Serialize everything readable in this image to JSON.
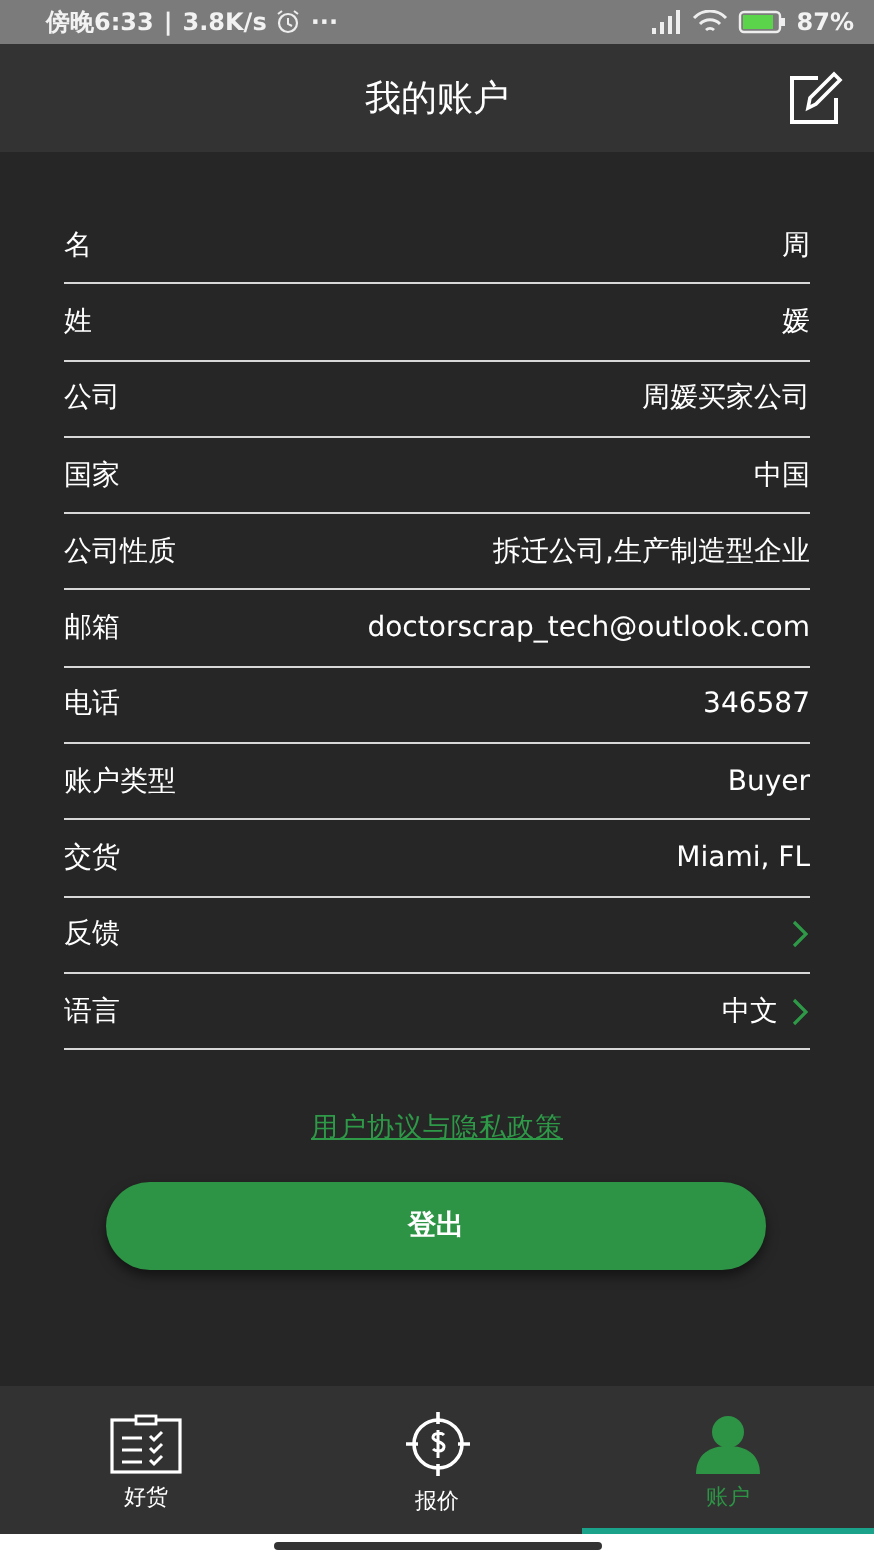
{
  "status_bar": {
    "time": "傍晚6:33",
    "separator": "|",
    "speed": "3.8K/s",
    "more": "···",
    "battery": "87%"
  },
  "header": {
    "title": "我的账户"
  },
  "fields": [
    {
      "label": "名",
      "value": "周",
      "chevron": false
    },
    {
      "label": "姓",
      "value": "媛",
      "chevron": false
    },
    {
      "label": "公司",
      "value": "周媛买家公司",
      "chevron": false
    },
    {
      "label": "国家",
      "value": "中国",
      "chevron": false
    },
    {
      "label": "公司性质",
      "value": "拆迁公司,生产制造型企业",
      "chevron": false
    },
    {
      "label": "邮箱",
      "value": "doctorscrap_tech@outlook.com",
      "chevron": false
    },
    {
      "label": "电话",
      "value": "346587",
      "chevron": false
    },
    {
      "label": "账户类型",
      "value": "Buyer",
      "chevron": false
    },
    {
      "label": "交货",
      "value": "Miami, FL",
      "chevron": false
    },
    {
      "label": "反馈",
      "chevron": true
    },
    {
      "label": "语言",
      "value": "中文",
      "chevron": true
    }
  ],
  "policy_link": "用户协议与隐私政策",
  "logout_button": "登出",
  "tabs": [
    {
      "kind": "goods",
      "label": "好货",
      "selected": false
    },
    {
      "kind": "quote",
      "label": "报价",
      "selected": false
    },
    {
      "kind": "account",
      "label": "账户",
      "selected": true
    }
  ]
}
